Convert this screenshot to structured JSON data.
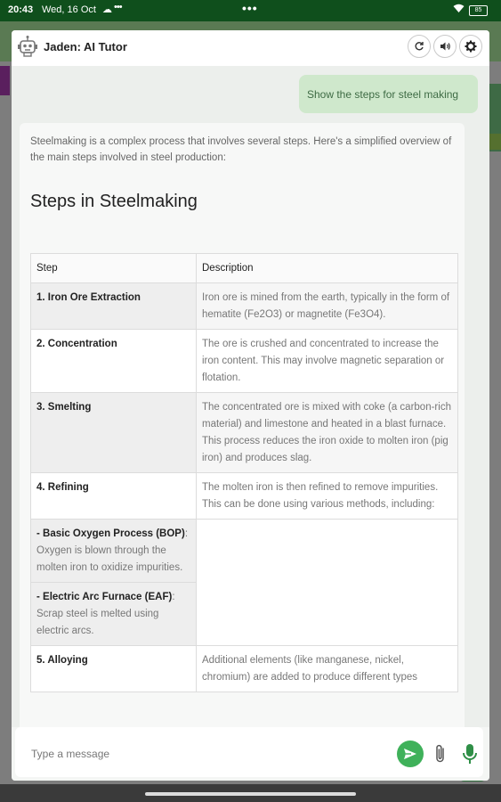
{
  "status_bar": {
    "time": "20:43",
    "date": "Wed, 16 Oct",
    "dots_left": "•••",
    "dots_center": "•••",
    "battery": "85"
  },
  "header": {
    "title": "Jaden: AI Tutor",
    "icons": [
      "robot-icon",
      "refresh-icon",
      "speaker-icon",
      "gear-icon"
    ]
  },
  "chat": {
    "user_message": "Show the steps for steel making",
    "intro": "Steelmaking is a complex process that involves several steps. Here's a simplified overview of the main steps involved in steel production:",
    "heading": "Steps in Steelmaking",
    "table": {
      "headers": [
        "Step",
        "Description"
      ],
      "rows": [
        {
          "step": "1. Iron Ore Extraction",
          "desc": "Iron ore is mined from the earth, typically in the form of hematite (Fe2O3) or magnetite (Fe3O4)."
        },
        {
          "step": "2. Concentration",
          "desc": "The ore is crushed and concentrated to increase the iron content. This may involve magnetic separation or flotation."
        },
        {
          "step": "3. Smelting",
          "desc": "The concentrated ore is mixed with coke (a carbon-rich material) and limestone and heated in a blast furnace. This process reduces the iron oxide to molten iron (pig iron) and produces slag."
        },
        {
          "step": "4. Refining",
          "desc": "The molten iron is then refined to remove impurities. This can be done using various methods, including:"
        },
        {
          "step_bold": "- Basic Oxygen Process (BOP)",
          "step_text": ": Oxygen is blown through the molten iron to oxidize impurities."
        },
        {
          "step_bold": "- Electric Arc Furnace (EAF)",
          "step_text": ": Scrap steel is melted using electric arcs."
        },
        {
          "step": "5. Alloying",
          "desc": "Additional elements (like manganese, nickel, chromium) are added to produce different types"
        }
      ]
    }
  },
  "composer": {
    "placeholder": "Type a message",
    "icons": [
      "send-icon",
      "attach-icon",
      "mic-icon"
    ]
  },
  "colors": {
    "status_bar": "#0f4f1c",
    "user_bubble": "#cfe8cc",
    "user_text": "#3e6b44",
    "send_button": "#3fb15a"
  }
}
